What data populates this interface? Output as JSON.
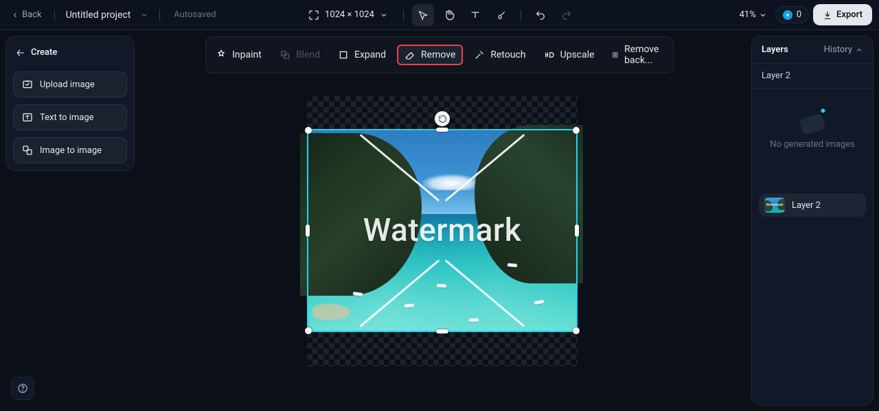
{
  "header": {
    "back": "Back",
    "project_name": "Untitled project",
    "autosaved": "Autosaved",
    "dimensions": "1024 × 1024",
    "zoom": "41%",
    "credits": "0",
    "export": "Export"
  },
  "toolstrip": {
    "inpaint": "Inpaint",
    "blend": "Blend",
    "expand": "Expand",
    "remove": "Remove",
    "retouch": "Retouch",
    "upscale": "Upscale",
    "remove_bg": "Remove back..."
  },
  "left": {
    "create": "Create",
    "upload": "Upload image",
    "text2img": "Text to image",
    "img2img": "Image to image"
  },
  "right": {
    "title": "Layers",
    "history": "History",
    "selected": "Layer 2",
    "empty": "No generated images",
    "item": "Layer 2"
  },
  "canvas": {
    "watermark": "Watermark"
  }
}
